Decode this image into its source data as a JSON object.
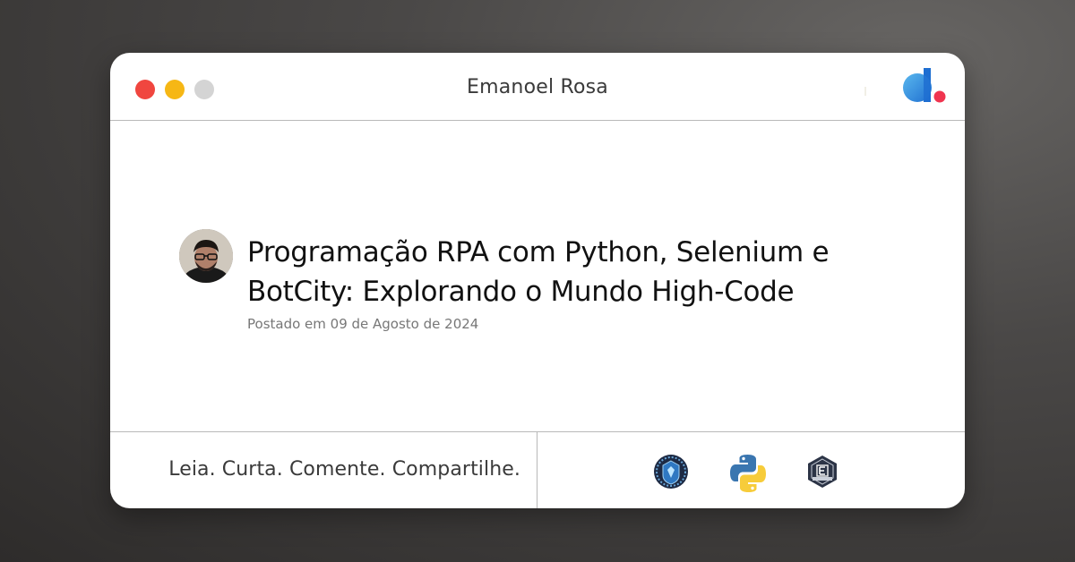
{
  "window": {
    "title": "Emanoel Rosa",
    "controls": [
      "close",
      "minimize",
      "maximize"
    ],
    "logo_icon": "brand-d-logo-icon"
  },
  "post": {
    "title": "Programação RPA com Python, Selenium e BotCity: Explorando o Mundo High-Code",
    "date": "Postado em 09 de Agosto de 2024",
    "author_avatar": "author-avatar"
  },
  "footer": {
    "tagline": "Leia. Curta. Comente. Compartilhe.",
    "badges": [
      "blue-crest-badge-icon",
      "python-logo-icon",
      "dark-hex-badge-icon"
    ]
  },
  "colors": {
    "close": "#f0463f",
    "minimize": "#f6b715",
    "maximize": "#d4d4d4",
    "logo_blue": "#1f6fd1",
    "logo_dot": "#f0344f",
    "python_blue": "#3a76b0",
    "python_yellow": "#f7cc3a"
  }
}
